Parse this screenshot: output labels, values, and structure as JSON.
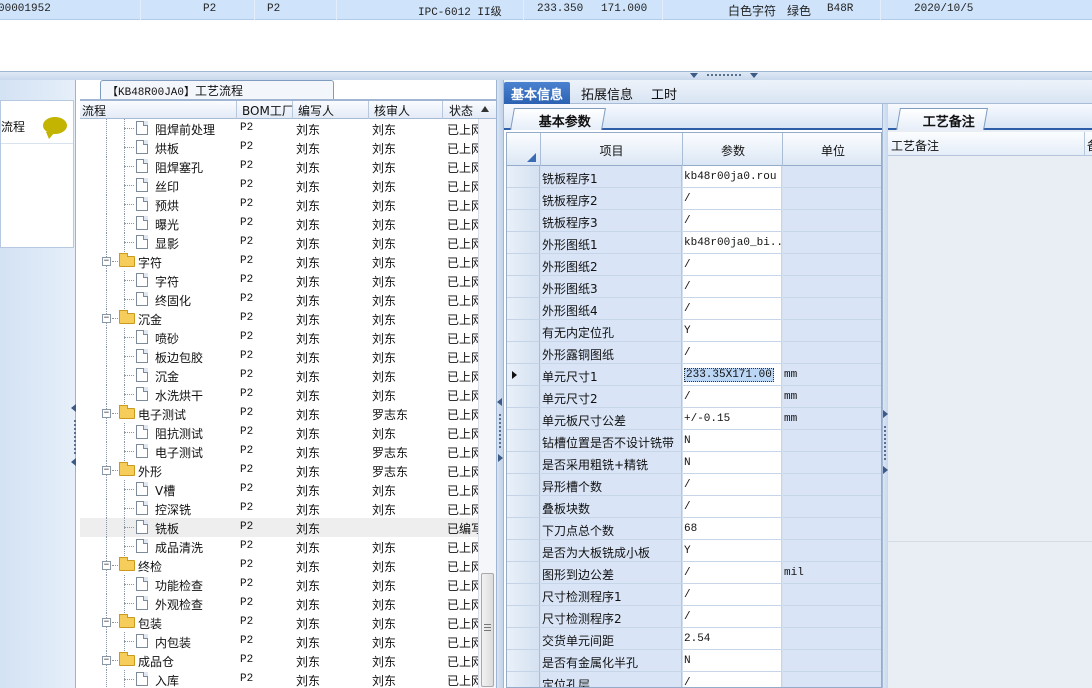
{
  "top_record": {
    "order_no": "00001952",
    "f1": "P2",
    "f2": "P2",
    "standard": "IPC-6012 II级",
    "width": "233.350",
    "height": "171.000",
    "char_color": "白色字符",
    "mask_color": "绿色",
    "code": "B48R",
    "date": "2020/10/5"
  },
  "left_panel": {
    "label": "流程"
  },
  "tree": {
    "tab_code": "【KB48R00JA0】",
    "tab_label": "工艺流程",
    "columns": [
      "流程",
      "BOM工厂",
      "编写人",
      "核审人",
      "状态"
    ],
    "rows": [
      {
        "name": "阻焊前处理",
        "level": 2,
        "factory": "P2",
        "writer": "刘东",
        "reviewer": "刘东",
        "status": "已上网"
      },
      {
        "name": "烘板",
        "level": 2,
        "factory": "P2",
        "writer": "刘东",
        "reviewer": "刘东",
        "status": "已上网"
      },
      {
        "name": "阻焊塞孔",
        "level": 2,
        "factory": "P2",
        "writer": "刘东",
        "reviewer": "刘东",
        "status": "已上网"
      },
      {
        "name": "丝印",
        "level": 2,
        "factory": "P2",
        "writer": "刘东",
        "reviewer": "刘东",
        "status": "已上网"
      },
      {
        "name": "预烘",
        "level": 2,
        "factory": "P2",
        "writer": "刘东",
        "reviewer": "刘东",
        "status": "已上网"
      },
      {
        "name": "曝光",
        "level": 2,
        "factory": "P2",
        "writer": "刘东",
        "reviewer": "刘东",
        "status": "已上网"
      },
      {
        "name": "显影",
        "level": 2,
        "factory": "P2",
        "writer": "刘东",
        "reviewer": "刘东",
        "status": "已上网"
      },
      {
        "name": "字符",
        "level": 1,
        "factory": "P2",
        "writer": "刘东",
        "reviewer": "刘东",
        "status": "已上网"
      },
      {
        "name": "字符",
        "level": 2,
        "factory": "P2",
        "writer": "刘东",
        "reviewer": "刘东",
        "status": "已上网"
      },
      {
        "name": "终固化",
        "level": 2,
        "factory": "P2",
        "writer": "刘东",
        "reviewer": "刘东",
        "status": "已上网"
      },
      {
        "name": "沉金",
        "level": 1,
        "factory": "P2",
        "writer": "刘东",
        "reviewer": "刘东",
        "status": "已上网"
      },
      {
        "name": "喷砂",
        "level": 2,
        "factory": "P2",
        "writer": "刘东",
        "reviewer": "刘东",
        "status": "已上网"
      },
      {
        "name": "板边包胶",
        "level": 2,
        "factory": "P2",
        "writer": "刘东",
        "reviewer": "刘东",
        "status": "已上网"
      },
      {
        "name": "沉金",
        "level": 2,
        "factory": "P2",
        "writer": "刘东",
        "reviewer": "刘东",
        "status": "已上网"
      },
      {
        "name": "水洗烘干",
        "level": 2,
        "factory": "P2",
        "writer": "刘东",
        "reviewer": "刘东",
        "status": "已上网"
      },
      {
        "name": "电子测试",
        "level": 1,
        "factory": "P2",
        "writer": "刘东",
        "reviewer": "罗志东",
        "status": "已上网"
      },
      {
        "name": "阻抗测试",
        "level": 2,
        "factory": "P2",
        "writer": "刘东",
        "reviewer": "刘东",
        "status": "已上网"
      },
      {
        "name": "电子测试",
        "level": 2,
        "factory": "P2",
        "writer": "刘东",
        "reviewer": "罗志东",
        "status": "已上网"
      },
      {
        "name": "外形",
        "level": 1,
        "factory": "P2",
        "writer": "刘东",
        "reviewer": "罗志东",
        "status": "已上网"
      },
      {
        "name": "V槽",
        "level": 2,
        "factory": "P2",
        "writer": "刘东",
        "reviewer": "刘东",
        "status": "已上网"
      },
      {
        "name": "控深铣",
        "level": 2,
        "factory": "P2",
        "writer": "刘东",
        "reviewer": "刘东",
        "status": "已上网"
      },
      {
        "name": "铣板",
        "level": 2,
        "factory": "P2",
        "writer": "刘东",
        "reviewer": "",
        "status": "已编写",
        "selected": true
      },
      {
        "name": "成品清洗",
        "level": 2,
        "factory": "P2",
        "writer": "刘东",
        "reviewer": "刘东",
        "status": "已上网"
      },
      {
        "name": "终检",
        "level": 1,
        "factory": "P2",
        "writer": "刘东",
        "reviewer": "刘东",
        "status": "已上网"
      },
      {
        "name": "功能检查",
        "level": 2,
        "factory": "P2",
        "writer": "刘东",
        "reviewer": "刘东",
        "status": "已上网"
      },
      {
        "name": "外观检查",
        "level": 2,
        "factory": "P2",
        "writer": "刘东",
        "reviewer": "刘东",
        "status": "已上网"
      },
      {
        "name": "包装",
        "level": 1,
        "factory": "P2",
        "writer": "刘东",
        "reviewer": "刘东",
        "status": "已上网"
      },
      {
        "name": "内包装",
        "level": 2,
        "factory": "P2",
        "writer": "刘东",
        "reviewer": "刘东",
        "status": "已上网"
      },
      {
        "name": "成品仓",
        "level": 1,
        "factory": "P2",
        "writer": "刘东",
        "reviewer": "刘东",
        "status": "已上网"
      },
      {
        "name": "入库",
        "level": 2,
        "factory": "P2",
        "writer": "刘东",
        "reviewer": "刘东",
        "status": "已上网"
      }
    ]
  },
  "main_tabs": [
    "基本信息",
    "拓展信息",
    "工时"
  ],
  "basic_params": {
    "tab_label": "基本参数",
    "columns": [
      "项目",
      "参数",
      "单位"
    ],
    "rows": [
      {
        "item": "铣板程序1",
        "value": "kb48r00ja0.rou",
        "unit": ""
      },
      {
        "item": "铣板程序2",
        "value": "/",
        "unit": ""
      },
      {
        "item": "铣板程序3",
        "value": "/",
        "unit": ""
      },
      {
        "item": "外形图纸1",
        "value": "kb48r00ja0_bi...",
        "unit": ""
      },
      {
        "item": "外形图纸2",
        "value": "/",
        "unit": ""
      },
      {
        "item": "外形图纸3",
        "value": "/",
        "unit": ""
      },
      {
        "item": "外形图纸4",
        "value": "/",
        "unit": ""
      },
      {
        "item": "有无内定位孔",
        "value": "Y",
        "unit": ""
      },
      {
        "item": "外形露铜图纸",
        "value": "/",
        "unit": ""
      },
      {
        "item": "单元尺寸1",
        "value": "233.35X171.00",
        "unit": "mm",
        "current": true
      },
      {
        "item": "单元尺寸2",
        "value": "/",
        "unit": "mm"
      },
      {
        "item": "单元板尺寸公差",
        "value": "+/-0.15",
        "unit": "mm"
      },
      {
        "item": "钻槽位置是否不设计铣带",
        "value": "N",
        "unit": ""
      },
      {
        "item": "是否采用粗铣+精铣",
        "value": "N",
        "unit": ""
      },
      {
        "item": "异形槽个数",
        "value": "/",
        "unit": ""
      },
      {
        "item": "叠板块数",
        "value": "/",
        "unit": ""
      },
      {
        "item": "下刀点总个数",
        "value": "68",
        "unit": ""
      },
      {
        "item": "是否为大板铣成小板",
        "value": "Y",
        "unit": ""
      },
      {
        "item": "图形到边公差",
        "value": "/",
        "unit": "mil"
      },
      {
        "item": "尺寸检测程序1",
        "value": "/",
        "unit": ""
      },
      {
        "item": "尺寸检测程序2",
        "value": "/",
        "unit": ""
      },
      {
        "item": "交货单元间距",
        "value": "2.54",
        "unit": ""
      },
      {
        "item": "是否有金属化半孔",
        "value": "N",
        "unit": ""
      },
      {
        "item": "定位孔层",
        "value": "/",
        "unit": ""
      }
    ]
  },
  "remark": {
    "tab_label": "工艺备注",
    "column": "工艺备注",
    "column2": "备"
  }
}
